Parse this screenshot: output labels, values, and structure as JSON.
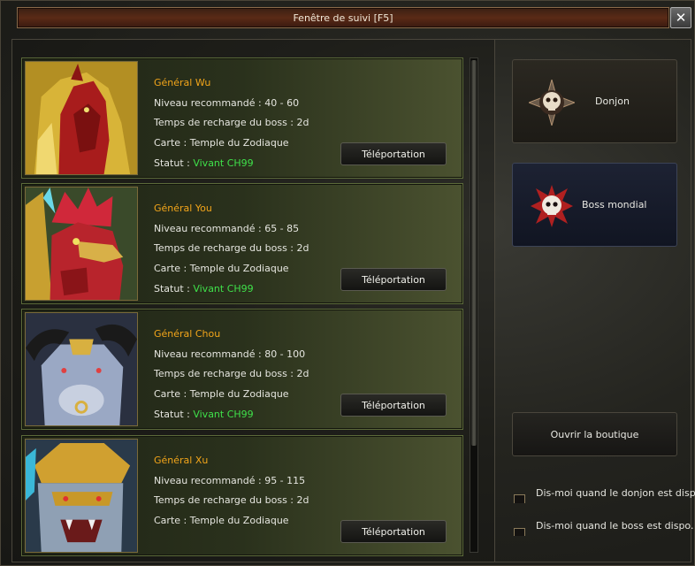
{
  "window": {
    "title": "Fenêtre de suivi [F5]",
    "close_glyph": "✕"
  },
  "bosses": [
    {
      "name": "Général Wu",
      "level": "Niveau recommandé : 40 - 60",
      "cooldown": "Temps de recharge du boss : 2d",
      "map": "Carte : Temple du Zodiaque",
      "status_label": "Statut : ",
      "status_value": "Vivant CH99",
      "teleport_label": "Téléportation",
      "portrait": "horse-general-portrait"
    },
    {
      "name": "Général You",
      "level": "Niveau recommandé : 65 - 85",
      "cooldown": "Temps de recharge du boss : 2d",
      "map": "Carte : Temple du Zodiaque",
      "status_label": "Statut : ",
      "status_value": "Vivant CH99",
      "teleport_label": "Téléportation",
      "portrait": "rooster-general-portrait"
    },
    {
      "name": "Général Chou",
      "level": "Niveau recommandé : 80 - 100",
      "cooldown": "Temps de recharge du boss : 2d",
      "map": "Carte : Temple du Zodiaque",
      "status_label": "Statut : ",
      "status_value": "Vivant CH99",
      "teleport_label": "Téléportation",
      "portrait": "ox-general-portrait"
    },
    {
      "name": "Général Xu",
      "level": "Niveau recommandé : 95 - 115",
      "cooldown": "Temps de recharge du boss : 2d",
      "map": "Carte : Temple du Zodiaque",
      "teleport_label": "Téléportation",
      "portrait": "dog-general-portrait"
    }
  ],
  "sidebar": {
    "dungeon_label": "Donjon",
    "dungeon_icon": "skull-compass-icon",
    "world_boss_label": "Boss mondial",
    "world_boss_icon": "skull-spikes-icon",
    "shop_label": "Ouvrir la boutique",
    "notify_dungeon_label": "Dis-moi quand le donjon est disp",
    "notify_boss_label": "Dis-moi quand le boss est dispo."
  },
  "colors": {
    "boss_name": "#f2a51a",
    "status_alive": "#3fe04a",
    "card_border": "#5c6a3a",
    "title_bar": "#5a2a16"
  }
}
